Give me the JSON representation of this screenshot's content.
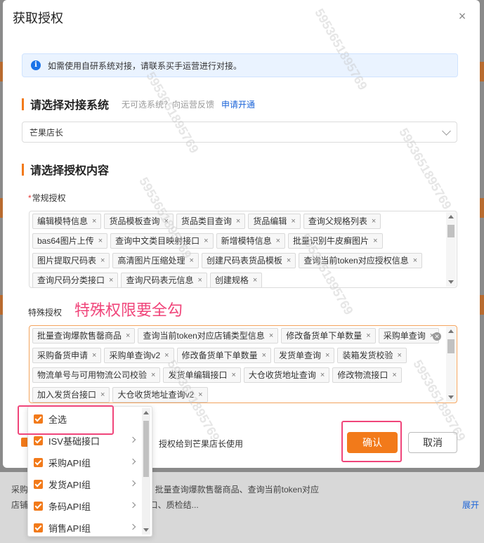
{
  "modal": {
    "title": "获取授权",
    "close_icon": "×",
    "info_icon_glyph": "i",
    "info_text": "如需使用自研系统对接，请联系买手运营进行对接。"
  },
  "system_section": {
    "title": "请选择对接系统",
    "subtitle": "无可选系统？向运营反馈",
    "link": "申请开通",
    "selected_value": "芒果店长"
  },
  "content_section": {
    "title": "请选择授权内容",
    "required_mark": "*",
    "regular_label": "常规授权",
    "regular_tags": [
      "编辑模特信息",
      "货品模板查询",
      "货品类目查询",
      "货品编辑",
      "查询父规格列表",
      "bas64图片上传",
      "查询中文类目映射接口",
      "新增模特信息",
      "批量识别牛皮癣图片",
      "图片提取尺码表",
      "高清图片压缩处理",
      "创建尺码表货品模板",
      "查询当前token对应授权信息",
      "查询尺码分类接口",
      "查询尺码表元信息",
      "创建规格"
    ],
    "special_label": "特殊授权",
    "special_tags": [
      "批量查询爆款售罄商品",
      "查询当前token对应店铺类型信息",
      "修改备货单下单数量",
      "采购单查询",
      "采购备货申请",
      "采购单查询v2",
      "修改备货单下单数量",
      "发货单查询",
      "装箱发货校验",
      "物流单号与可用物流公司校验",
      "发货单编辑接口",
      "大仓收货地址查询",
      "修改物流接口",
      "加入发货台接口",
      "大仓收货地址查询v2"
    ],
    "tag_close": "×"
  },
  "annotation": "特殊权限要全勾",
  "dropdown": {
    "items": [
      {
        "label": "全选",
        "has_arrow": false
      },
      {
        "label": "ISV基础接口",
        "has_arrow": true
      },
      {
        "label": "采购API组",
        "has_arrow": true
      },
      {
        "label": "发货API组",
        "has_arrow": true
      },
      {
        "label": "条码API组",
        "has_arrow": true
      },
      {
        "label": "销售API组",
        "has_arrow": true
      }
    ]
  },
  "footer": {
    "agreement_text": "授权给到芒果店长使用",
    "confirm_label": "确认",
    "cancel_label": "取消"
  },
  "background": {
    "bottom_line1": "采购单查询v2、修改备货单下单数量、批量查询爆款售罄商品、查询当前token对应",
    "bottom_line2": "店铺 ... 货品品牌查询、说明书翻译接口、质检结...",
    "expand_link": "展开"
  },
  "watermark": "5953651895769",
  "colors": {
    "accent": "#f27a1a",
    "link": "#1a63d8",
    "highlight": "#f0457a"
  }
}
